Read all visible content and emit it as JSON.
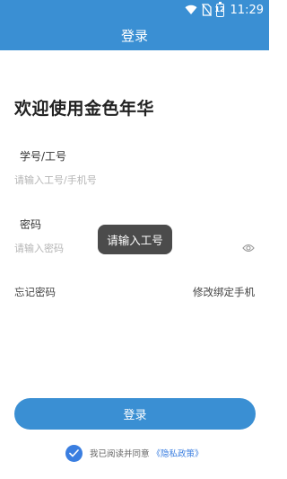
{
  "status_bar": {
    "time": "11:29",
    "battery_level": "12",
    "icons": [
      "wifi-icon",
      "no-sim-icon",
      "battery-icon"
    ]
  },
  "header": {
    "title": "登录"
  },
  "welcome_text": "欢迎使用金色年华",
  "form": {
    "id_label": "学号/工号",
    "id_placeholder": "请输入工号/手机号",
    "id_value": "",
    "password_label": "密码",
    "password_placeholder": "请输入密码",
    "password_value": ""
  },
  "toast": {
    "message": "请输入工号"
  },
  "links": {
    "forgot_password": "忘记密码",
    "change_phone": "修改绑定手机"
  },
  "login_button": "登录",
  "agreement": {
    "checked": true,
    "text": "我已阅读并同意",
    "privacy_link": "《隐私政策》"
  },
  "colors": {
    "primary": "#3a8fd3",
    "link": "#3a7ee0",
    "toast_bg": "#3c3c3c"
  }
}
